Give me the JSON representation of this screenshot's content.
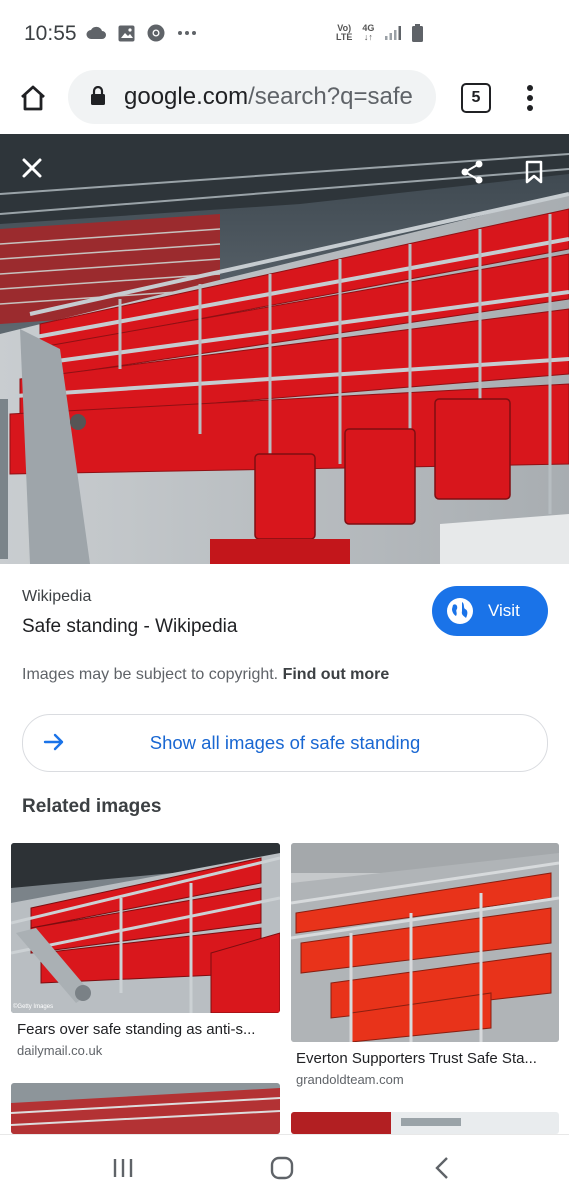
{
  "status_bar": {
    "time": "10:55",
    "left_icons": [
      "cloud-icon",
      "image-icon",
      "chrome-icon",
      "more-dots-icon"
    ],
    "network_top": "Vo)",
    "network_bottom": "LTE",
    "data_top": "4G",
    "data_bottom": "↓↑",
    "right_icons": [
      "signal-icon",
      "battery-icon"
    ]
  },
  "browser": {
    "url_domain": "google.com",
    "url_path": "/search?q=safe",
    "tab_count": "5"
  },
  "viewer": {
    "source": "Wikipedia",
    "title": "Safe standing - Wikipedia",
    "visit_label": "Visit",
    "copyright_text": "Images may be subject to copyright.",
    "copyright_link": "Find out more",
    "show_all_label": "Show all images of safe standing",
    "related_heading": "Related images"
  },
  "related_images": [
    {
      "title": "Fears over safe standing as anti-s...",
      "source": "dailymail.co.uk",
      "watermark": "©Getty Images"
    },
    {
      "title": "Everton Supporters Trust Safe Sta...",
      "source": "grandoldteam.com"
    }
  ],
  "colors": {
    "accent": "#1a73e8",
    "link": "#1967d2",
    "seat_red": "#d8161c"
  }
}
